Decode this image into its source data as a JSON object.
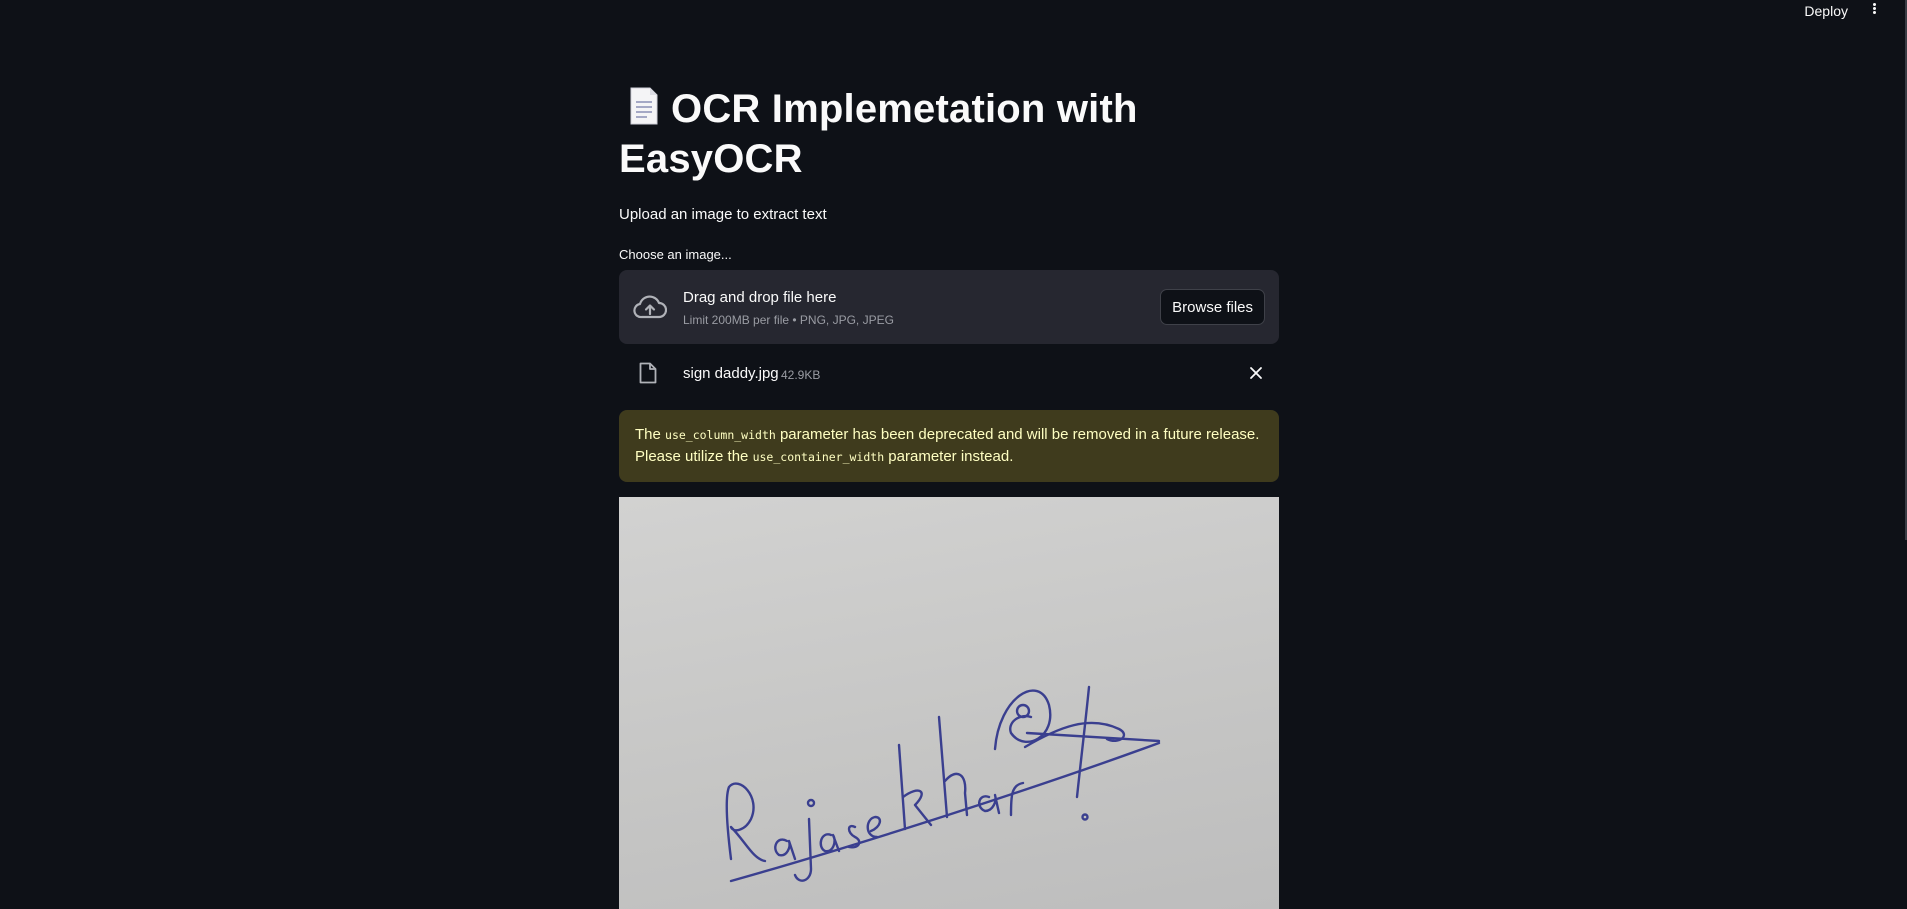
{
  "header": {
    "deploy_label": "Deploy",
    "menu_icon": "kebab-menu-icon"
  },
  "page": {
    "title_icon": "page-facing-up-icon",
    "title": "OCR Implemetation with EasyOCR",
    "subtitle": "Upload an image to extract text"
  },
  "uploader": {
    "label": "Choose an image...",
    "drop_text": "Drag and drop file here",
    "limit_text": "Limit 200MB per file • PNG, JPG, JPEG",
    "browse_label": "Browse files",
    "upload_icon": "cloud-upload-icon"
  },
  "uploaded_file": {
    "name": "sign daddy.jpg",
    "size": "42.9KB",
    "file_icon": "file-icon",
    "remove_icon": "close-icon"
  },
  "warning": {
    "pre": "The ",
    "code1": "use_column_width",
    "mid": " parameter has been deprecated and will be removed in a future release. Please utilize the ",
    "code2": "use_container_width",
    "post": " parameter instead."
  },
  "image": {
    "signature_text": "Rajasekhar"
  },
  "colors": {
    "background": "#0e1117",
    "dropzone": "#262730",
    "warning_bg": "#3f3b1d",
    "warning_text": "#ffffc2",
    "ink": "#3a3f8f"
  }
}
